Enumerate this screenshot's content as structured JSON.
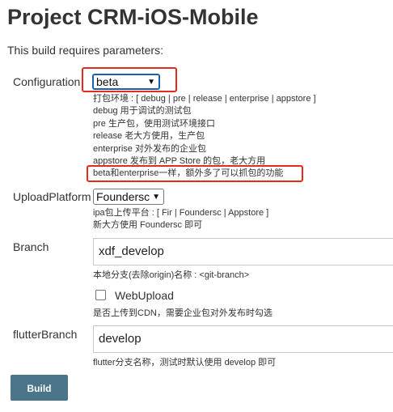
{
  "page": {
    "title": "Project CRM-iOS-Mobile",
    "subtitle": "This build requires parameters:"
  },
  "params": {
    "configuration": {
      "label": "Configuration",
      "value": "beta",
      "description": [
        "打包环境 : [ debug | pre | release | enterprise | appstore ]",
        "debug 用于调试的测试包",
        "pre 生产包，使用测试环境接口",
        "release 老大方使用，生产包",
        "enterprise 对外发布的企业包",
        "appstore 发布到 APP Store 的包，老大方用",
        "beta和enterprise一样，额外多了可以抓包的功能"
      ]
    },
    "upload_platform": {
      "label": "UploadPlatform",
      "value": "Foundersc",
      "description": [
        "ipa包上传平台 : [ Fir | Foundersc | Appstore ]",
        "新大方使用 Foundersc 即可"
      ]
    },
    "branch": {
      "label": "Branch",
      "value": "xdf_develop",
      "description": "本地分支(去除origin)名称 : <git-branch>"
    },
    "web_upload": {
      "label": "WebUpload",
      "checked": false,
      "description": "是否上传到CDN，需要企业包对外发布时勾选"
    },
    "flutter_branch": {
      "label": "flutterBranch",
      "value": "develop",
      "description": "flutter分支名称，测试时默认使用 develop 即可"
    }
  },
  "actions": {
    "build_label": "Build"
  },
  "colors": {
    "annotation": "#e52b1e",
    "button": "#4b758b",
    "select_focus": "#1a5fb4"
  }
}
